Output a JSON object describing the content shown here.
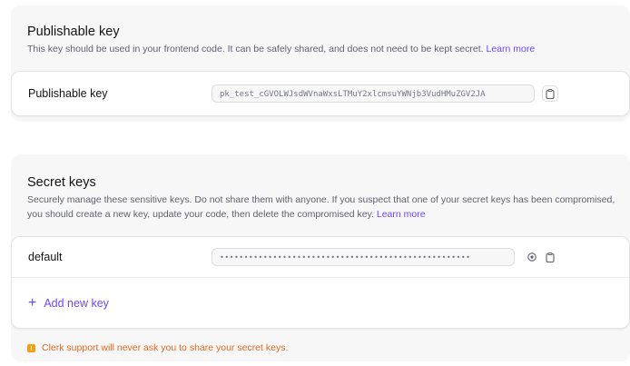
{
  "publishable": {
    "title": "Publishable key",
    "description": "This key should be used in your frontend code. It can be safely shared, and does not need to be kept secret.",
    "learn_more": "Learn more",
    "row_label": "Publishable key",
    "key_value": "pk_test_cGVOLWJsdWVnaWxsLTMuY2xlcmsuYWNjb3VudHMuZGV2JA",
    "copy_icon": "clipboard-icon"
  },
  "secret": {
    "title": "Secret keys",
    "description": "Securely manage these sensitive keys. Do not share them with anyone. If you suspect that one of your secret keys has been compromised, you should create a new key, update your code, then delete the compromised key.",
    "learn_more": "Learn more",
    "keys": [
      {
        "name": "default",
        "masked_value": "••••••••••••••••••••••••••••••••••••••••••••••••••••",
        "reveal_icon": "eye-icon",
        "copy_icon": "clipboard-icon"
      }
    ],
    "add_label": "Add new key",
    "add_icon": "plus-icon",
    "notice": "Clerk support will never ask you to share your secret keys.",
    "notice_icon": "warning-icon"
  },
  "colors": {
    "accent": "#6c47ff",
    "warning": "#e2691f",
    "section_bg": "#f7f7f8"
  }
}
